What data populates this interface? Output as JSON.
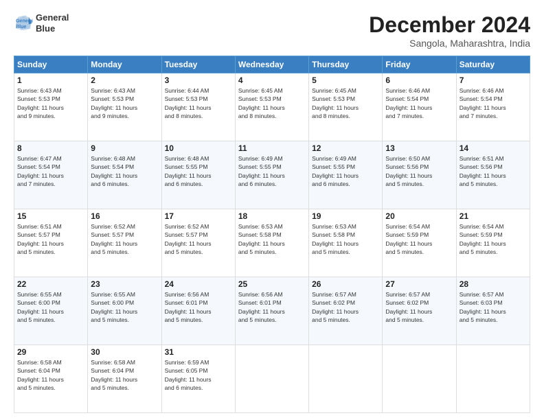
{
  "logo": {
    "line1": "General",
    "line2": "Blue"
  },
  "title": "December 2024",
  "subtitle": "Sangola, Maharashtra, India",
  "weekdays": [
    "Sunday",
    "Monday",
    "Tuesday",
    "Wednesday",
    "Thursday",
    "Friday",
    "Saturday"
  ],
  "weeks": [
    [
      {
        "day": "1",
        "info": "Sunrise: 6:43 AM\nSunset: 5:53 PM\nDaylight: 11 hours\nand 9 minutes."
      },
      {
        "day": "2",
        "info": "Sunrise: 6:43 AM\nSunset: 5:53 PM\nDaylight: 11 hours\nand 9 minutes."
      },
      {
        "day": "3",
        "info": "Sunrise: 6:44 AM\nSunset: 5:53 PM\nDaylight: 11 hours\nand 8 minutes."
      },
      {
        "day": "4",
        "info": "Sunrise: 6:45 AM\nSunset: 5:53 PM\nDaylight: 11 hours\nand 8 minutes."
      },
      {
        "day": "5",
        "info": "Sunrise: 6:45 AM\nSunset: 5:53 PM\nDaylight: 11 hours\nand 8 minutes."
      },
      {
        "day": "6",
        "info": "Sunrise: 6:46 AM\nSunset: 5:54 PM\nDaylight: 11 hours\nand 7 minutes."
      },
      {
        "day": "7",
        "info": "Sunrise: 6:46 AM\nSunset: 5:54 PM\nDaylight: 11 hours\nand 7 minutes."
      }
    ],
    [
      {
        "day": "8",
        "info": "Sunrise: 6:47 AM\nSunset: 5:54 PM\nDaylight: 11 hours\nand 7 minutes."
      },
      {
        "day": "9",
        "info": "Sunrise: 6:48 AM\nSunset: 5:54 PM\nDaylight: 11 hours\nand 6 minutes."
      },
      {
        "day": "10",
        "info": "Sunrise: 6:48 AM\nSunset: 5:55 PM\nDaylight: 11 hours\nand 6 minutes."
      },
      {
        "day": "11",
        "info": "Sunrise: 6:49 AM\nSunset: 5:55 PM\nDaylight: 11 hours\nand 6 minutes."
      },
      {
        "day": "12",
        "info": "Sunrise: 6:49 AM\nSunset: 5:55 PM\nDaylight: 11 hours\nand 6 minutes."
      },
      {
        "day": "13",
        "info": "Sunrise: 6:50 AM\nSunset: 5:56 PM\nDaylight: 11 hours\nand 5 minutes."
      },
      {
        "day": "14",
        "info": "Sunrise: 6:51 AM\nSunset: 5:56 PM\nDaylight: 11 hours\nand 5 minutes."
      }
    ],
    [
      {
        "day": "15",
        "info": "Sunrise: 6:51 AM\nSunset: 5:57 PM\nDaylight: 11 hours\nand 5 minutes."
      },
      {
        "day": "16",
        "info": "Sunrise: 6:52 AM\nSunset: 5:57 PM\nDaylight: 11 hours\nand 5 minutes."
      },
      {
        "day": "17",
        "info": "Sunrise: 6:52 AM\nSunset: 5:57 PM\nDaylight: 11 hours\nand 5 minutes."
      },
      {
        "day": "18",
        "info": "Sunrise: 6:53 AM\nSunset: 5:58 PM\nDaylight: 11 hours\nand 5 minutes."
      },
      {
        "day": "19",
        "info": "Sunrise: 6:53 AM\nSunset: 5:58 PM\nDaylight: 11 hours\nand 5 minutes."
      },
      {
        "day": "20",
        "info": "Sunrise: 6:54 AM\nSunset: 5:59 PM\nDaylight: 11 hours\nand 5 minutes."
      },
      {
        "day": "21",
        "info": "Sunrise: 6:54 AM\nSunset: 5:59 PM\nDaylight: 11 hours\nand 5 minutes."
      }
    ],
    [
      {
        "day": "22",
        "info": "Sunrise: 6:55 AM\nSunset: 6:00 PM\nDaylight: 11 hours\nand 5 minutes."
      },
      {
        "day": "23",
        "info": "Sunrise: 6:55 AM\nSunset: 6:00 PM\nDaylight: 11 hours\nand 5 minutes."
      },
      {
        "day": "24",
        "info": "Sunrise: 6:56 AM\nSunset: 6:01 PM\nDaylight: 11 hours\nand 5 minutes."
      },
      {
        "day": "25",
        "info": "Sunrise: 6:56 AM\nSunset: 6:01 PM\nDaylight: 11 hours\nand 5 minutes."
      },
      {
        "day": "26",
        "info": "Sunrise: 6:57 AM\nSunset: 6:02 PM\nDaylight: 11 hours\nand 5 minutes."
      },
      {
        "day": "27",
        "info": "Sunrise: 6:57 AM\nSunset: 6:02 PM\nDaylight: 11 hours\nand 5 minutes."
      },
      {
        "day": "28",
        "info": "Sunrise: 6:57 AM\nSunset: 6:03 PM\nDaylight: 11 hours\nand 5 minutes."
      }
    ],
    [
      {
        "day": "29",
        "info": "Sunrise: 6:58 AM\nSunset: 6:04 PM\nDaylight: 11 hours\nand 5 minutes."
      },
      {
        "day": "30",
        "info": "Sunrise: 6:58 AM\nSunset: 6:04 PM\nDaylight: 11 hours\nand 5 minutes."
      },
      {
        "day": "31",
        "info": "Sunrise: 6:59 AM\nSunset: 6:05 PM\nDaylight: 11 hours\nand 6 minutes."
      },
      null,
      null,
      null,
      null
    ]
  ]
}
